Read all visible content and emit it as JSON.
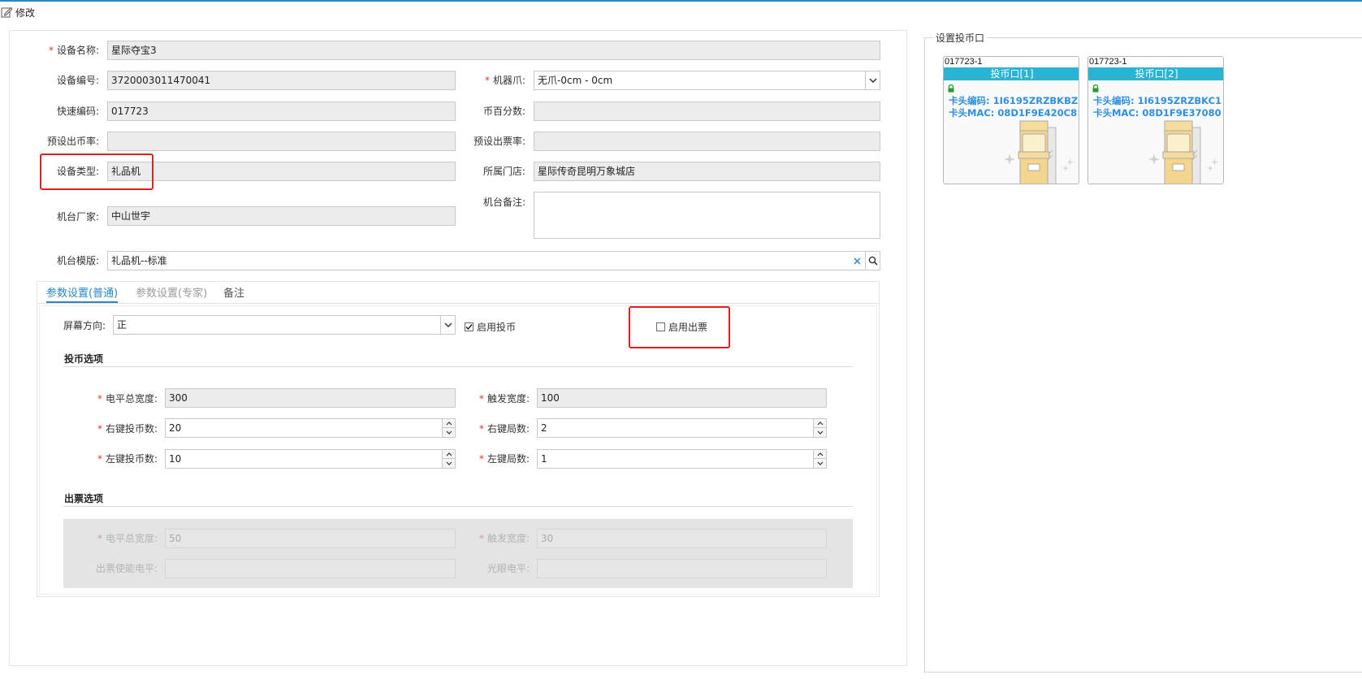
{
  "window": {
    "title": "修改",
    "edit_icon": "edit-icon"
  },
  "form": {
    "device_name": {
      "label": "设备名称:",
      "value": "星际夺宝3",
      "required": true
    },
    "device_code": {
      "label": "设备编号:",
      "value": "3720003011470041"
    },
    "claw": {
      "label": "机器爪:",
      "value": "无爪-0cm - 0cm",
      "required": true
    },
    "quick_code": {
      "label": "快速编码:",
      "value": "017723"
    },
    "coin_percent": {
      "label": "币百分数:",
      "value": ""
    },
    "preset_coin_rate": {
      "label": "预设出币率:",
      "value": ""
    },
    "preset_ticket_rate": {
      "label": "预设出票率:",
      "value": ""
    },
    "device_type": {
      "label": "设备类型:",
      "value": "礼品机"
    },
    "store": {
      "label": "所属门店:",
      "value": "星际传奇昆明万象城店"
    },
    "manufacturer": {
      "label": "机台厂家:",
      "value": "中山世宇"
    },
    "remark": {
      "label": "机台备注:",
      "value": ""
    },
    "template": {
      "label": "机台模版:",
      "value": "礼品机--标准"
    }
  },
  "tabs": [
    {
      "label": "参数设置(普通)",
      "state": "active"
    },
    {
      "label": "参数设置(专家)",
      "state": "inactive"
    },
    {
      "label": "备注",
      "state": "normal"
    }
  ],
  "params": {
    "screen_direction": {
      "label": "屏幕方向:",
      "value": "正"
    },
    "enable_coin": {
      "label": "启用投币",
      "checked": true
    },
    "enable_ticket": {
      "label": "启用出票",
      "checked": false
    },
    "coin_section": {
      "title": "投币选项",
      "level_total_width": {
        "label": "电平总宽度:",
        "value": "300"
      },
      "trigger_width": {
        "label": "触发宽度:",
        "value": "100"
      },
      "right_coins": {
        "label": "右键投币数:",
        "value": "20"
      },
      "right_games": {
        "label": "右键局数:",
        "value": "2"
      },
      "left_coins": {
        "label": "左键投币数:",
        "value": "10"
      },
      "left_games": {
        "label": "左键局数:",
        "value": "1"
      }
    },
    "ticket_section": {
      "title": "出票选项",
      "level_total_width": {
        "label": "电平总宽度:",
        "value": "50"
      },
      "trigger_width": {
        "label": "触发宽度:",
        "value": "30"
      },
      "ticket_enable_level": {
        "label": "出票使能电平:",
        "value": ""
      },
      "photo_level": {
        "label": "光眼电平:",
        "value": ""
      }
    }
  },
  "coin_slots": {
    "legend": "设置投币口",
    "cards": [
      {
        "id": "017723-1",
        "title": "投币口[1]",
        "code_line": "卡头编码: 1I6195ZRZBKBZ",
        "mac_line": "卡头MAC: 08D1F9E420C8"
      },
      {
        "id": "017723-1",
        "title": "投币口[2]",
        "code_line": "卡头编码: 1I6195ZRZBKC1",
        "mac_line": "卡头MAC: 08D1F9E37080"
      }
    ]
  },
  "colors": {
    "accent": "#2a86c8",
    "required": "#e23434",
    "highlight_box": "#e02020",
    "card_header": "#29b4d6",
    "card_text": "#2f8fe0"
  }
}
